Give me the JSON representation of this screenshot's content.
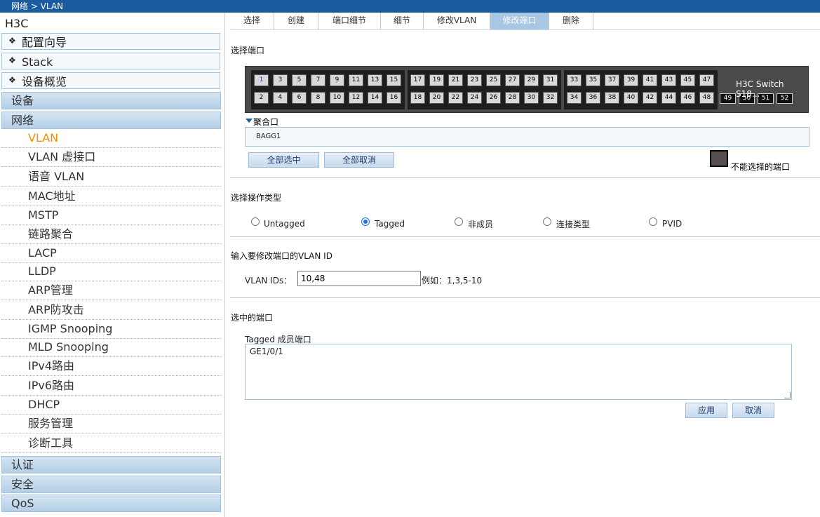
{
  "header": {
    "breadcrumb": "网络 > VLAN"
  },
  "sidebar": {
    "brand": "H3C",
    "wizards": [
      "配置向导",
      "Stack",
      "设备概览"
    ],
    "categories_top": [
      "设备",
      "网络"
    ],
    "network_items": [
      "VLAN",
      "VLAN 虚接口",
      "语音 VLAN",
      "MAC地址",
      "MSTP",
      "链路聚合",
      "LACP",
      "LLDP",
      "ARP管理",
      "ARP防攻击",
      "IGMP Snooping",
      "MLD Snooping",
      "IPv4路由",
      "IPv6路由",
      "DHCP",
      "服务管理",
      "诊断工具"
    ],
    "active_item": "VLAN",
    "categories_bottom": [
      "认证",
      "安全",
      "QoS"
    ]
  },
  "tabs": [
    "选择",
    "创建",
    "端口细节",
    "细节",
    "修改VLAN",
    "修改端口",
    "删除"
  ],
  "active_tab": "修改端口",
  "select_ports": {
    "title": "选择端口",
    "switch_name": "H3C Switch S18...",
    "ports": {
      "top": [
        1,
        3,
        5,
        7,
        9,
        11,
        13,
        15,
        17,
        19,
        21,
        23,
        25,
        27,
        29,
        31,
        33,
        35,
        37,
        39,
        41,
        43,
        45,
        47
      ],
      "bottom": [
        2,
        4,
        6,
        8,
        10,
        12,
        14,
        16,
        18,
        20,
        22,
        24,
        26,
        28,
        30,
        32,
        34,
        36,
        38,
        40,
        42,
        44,
        46,
        48
      ],
      "uplink": [
        49,
        50,
        51,
        52
      ]
    },
    "selected_port": 1,
    "aggregation_label": "聚合口",
    "aggregation_item": "BAGG1",
    "select_all": "全部选中",
    "deselect_all": "全部取消",
    "legend_label": "不能选择的端口"
  },
  "operation": {
    "title": "选择操作类型",
    "options": [
      "Untagged",
      "Tagged",
      "非成员",
      "连接类型",
      "PVID"
    ],
    "selected": "Tagged"
  },
  "vlan": {
    "title": "输入要修改端口的VLAN ID",
    "label": "VLAN IDs：",
    "value": "10,48",
    "example": "例如：1,3,5-10"
  },
  "selected_ports": {
    "title": "选中的端口",
    "label": "Tagged 成员端口",
    "value": "GE1/0/1"
  },
  "actions": {
    "apply": "应用",
    "cancel": "取消"
  }
}
